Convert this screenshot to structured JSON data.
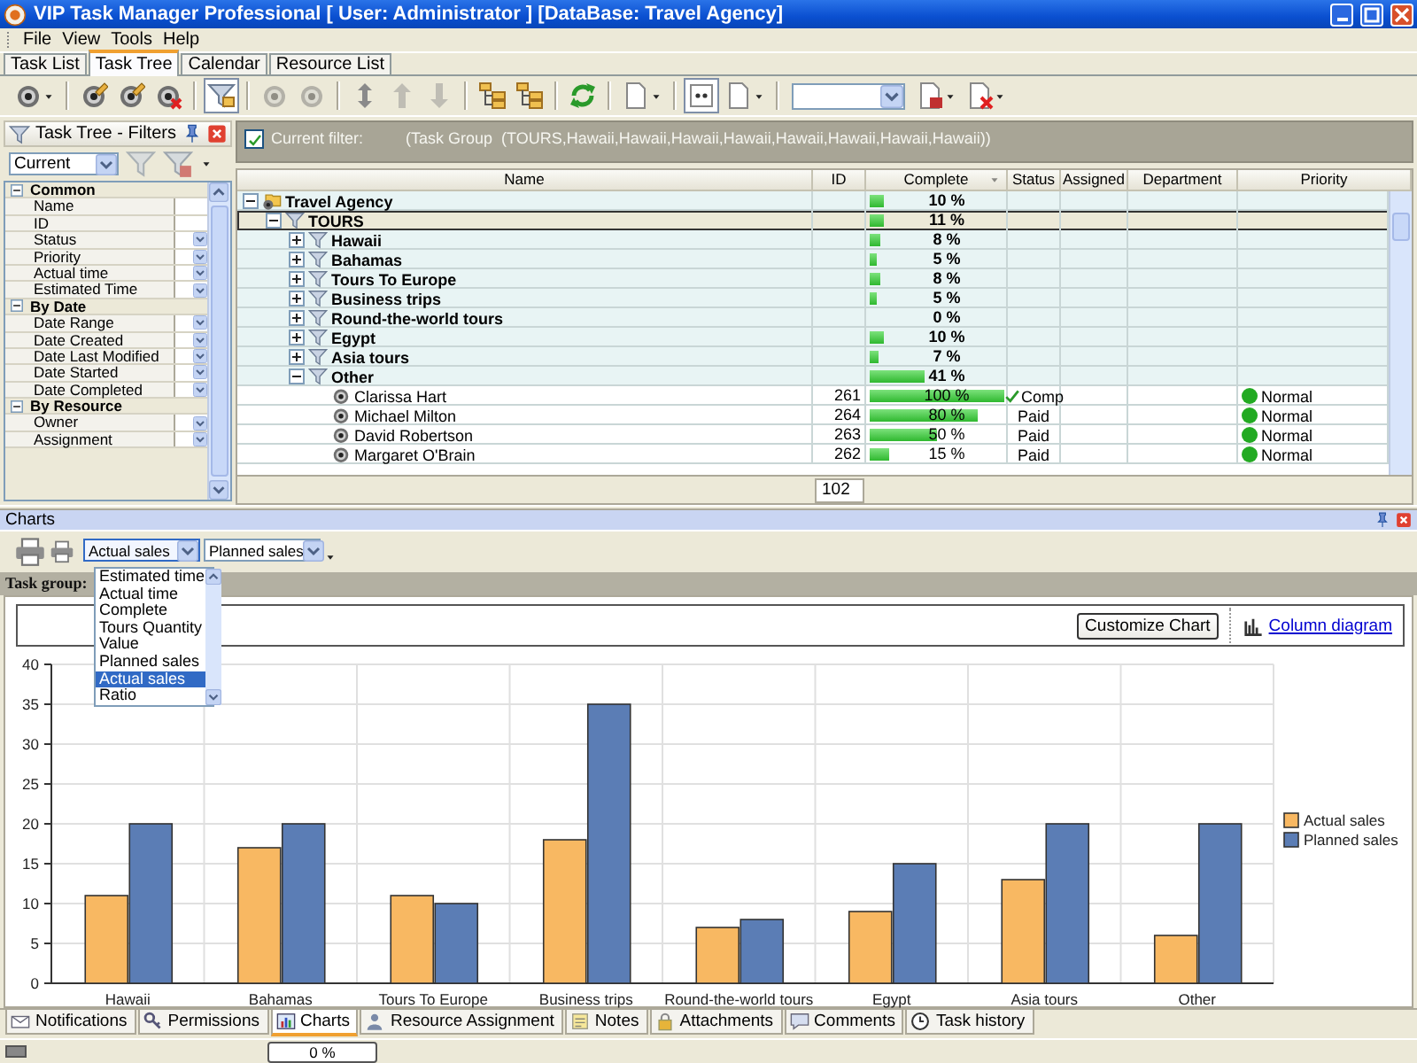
{
  "window": {
    "title": "VIP Task Manager Professional [ User: Administrator ] [DataBase: Travel Agency]"
  },
  "menu": [
    "File",
    "View",
    "Tools",
    "Help"
  ],
  "view_tabs": [
    {
      "label": "Task List",
      "selected": false
    },
    {
      "label": "Task Tree",
      "selected": true
    },
    {
      "label": "Calendar",
      "selected": false
    },
    {
      "label": "Resource List",
      "selected": false
    }
  ],
  "toolbar": [
    {
      "kind": "gear",
      "menu": true,
      "pressed": false,
      "disabled": false
    },
    {
      "kind": "separator"
    },
    {
      "kind": "gear-edit",
      "menu": false,
      "pressed": false,
      "disabled": false
    },
    {
      "kind": "gear-edit",
      "menu": false,
      "pressed": false,
      "disabled": false
    },
    {
      "kind": "gear-delete",
      "menu": false,
      "pressed": false,
      "disabled": false
    },
    {
      "kind": "separator"
    },
    {
      "kind": "funnel",
      "menu": false,
      "pressed": true,
      "disabled": false
    },
    {
      "kind": "separator"
    },
    {
      "kind": "gear",
      "menu": false,
      "pressed": false,
      "disabled": true
    },
    {
      "kind": "gear",
      "menu": false,
      "pressed": false,
      "disabled": true
    },
    {
      "kind": "separator"
    },
    {
      "kind": "up-down",
      "menu": false,
      "pressed": false,
      "disabled": false
    },
    {
      "kind": "up",
      "menu": false,
      "pressed": false,
      "disabled": true
    },
    {
      "kind": "down",
      "menu": false,
      "pressed": false,
      "disabled": true
    },
    {
      "kind": "separator"
    },
    {
      "kind": "tree",
      "menu": false,
      "pressed": false,
      "disabled": false
    },
    {
      "kind": "tree",
      "menu": false,
      "pressed": false,
      "disabled": false
    },
    {
      "kind": "separator"
    },
    {
      "kind": "refresh",
      "menu": false,
      "pressed": false,
      "disabled": false
    },
    {
      "kind": "separator"
    },
    {
      "kind": "page",
      "menu": true,
      "pressed": false,
      "disabled": false
    },
    {
      "kind": "separator"
    },
    {
      "kind": "columns",
      "menu": false,
      "pressed": true,
      "disabled": false
    },
    {
      "kind": "page",
      "menu": true,
      "pressed": false,
      "disabled": false
    },
    {
      "kind": "separator"
    },
    {
      "kind": "combo"
    },
    {
      "kind": "page-save",
      "menu": true,
      "pressed": false,
      "disabled": false
    },
    {
      "kind": "page-delete",
      "menu": true,
      "pressed": false,
      "disabled": false
    }
  ],
  "filters": {
    "title": "Task Tree - Filters",
    "preset": "Current",
    "groups": [
      {
        "label": "Common",
        "expanded": true,
        "items": [
          {
            "label": "Name",
            "dropdown": false
          },
          {
            "label": "ID",
            "dropdown": false
          },
          {
            "label": "Status",
            "dropdown": true
          },
          {
            "label": "Priority",
            "dropdown": true
          },
          {
            "label": "Actual time",
            "dropdown": true
          },
          {
            "label": "Estimated Time",
            "dropdown": true
          }
        ]
      },
      {
        "label": "By Date",
        "expanded": true,
        "items": [
          {
            "label": "Date Range",
            "dropdown": true
          },
          {
            "label": "Date Created",
            "dropdown": true
          },
          {
            "label": "Date Last Modified",
            "dropdown": true
          },
          {
            "label": "Date Started",
            "dropdown": true
          },
          {
            "label": "Date Completed",
            "dropdown": true
          }
        ]
      },
      {
        "label": "By Resource",
        "expanded": true,
        "items": [
          {
            "label": "Owner",
            "dropdown": true
          },
          {
            "label": "Assignment",
            "dropdown": true
          }
        ]
      }
    ]
  },
  "filter_bar": {
    "checked": true,
    "label": "Current filter:",
    "value": "(Task Group  (TOURS,Hawaii,Hawaii,Hawaii,Hawaii,Hawaii,Hawaii,Hawaii,Hawaii))"
  },
  "tree": {
    "columns": [
      "Name",
      "ID",
      "Complete",
      "Status",
      "Assigned",
      "Department",
      "Priority"
    ],
    "rows": [
      {
        "kind": "root",
        "name": "Travel Agency",
        "complete": "10 %",
        "level": 0.1,
        "expanded": true,
        "selected": false,
        "children": [
          {
            "kind": "group",
            "name": "TOURS",
            "complete": "11 %",
            "level": 0.11,
            "expanded": true,
            "selected": true,
            "children": [
              {
                "kind": "group",
                "name": "Hawaii",
                "complete": "8 %",
                "level": 0.08,
                "expanded": false,
                "selected": false
              },
              {
                "kind": "group",
                "name": "Bahamas",
                "complete": "5 %",
                "level": 0.05,
                "expanded": false,
                "selected": false
              },
              {
                "kind": "group",
                "name": "Tours To Europe",
                "complete": "8 %",
                "level": 0.08,
                "expanded": false,
                "selected": false
              },
              {
                "kind": "group",
                "name": "Business trips",
                "complete": "5 %",
                "level": 0.05,
                "expanded": false,
                "selected": false
              },
              {
                "kind": "group",
                "name": "Round-the-world tours",
                "complete": "0 %",
                "level": 0,
                "expanded": false,
                "selected": false
              },
              {
                "kind": "group",
                "name": "Egypt",
                "complete": "10 %",
                "level": 0.1,
                "expanded": false,
                "selected": false
              },
              {
                "kind": "group",
                "name": "Asia tours",
                "complete": "7 %",
                "level": 0.07,
                "expanded": false,
                "selected": false
              },
              {
                "kind": "group",
                "name": "Other",
                "complete": "41 %",
                "level": 0.41,
                "expanded": true,
                "selected": false,
                "children": [
                  {
                    "kind": "task",
                    "name": "Clarissa Hart",
                    "id": "261",
                    "complete": "100 %",
                    "level": 1,
                    "status": "Comp",
                    "completed": true,
                    "priority": "Normal",
                    "color": "#22aa22",
                    "selected": false
                  },
                  {
                    "kind": "task",
                    "name": "Michael Milton",
                    "id": "264",
                    "complete": "80 %",
                    "level": 0.8,
                    "status": "Paid",
                    "completed": false,
                    "priority": "Normal",
                    "color": "#22aa22",
                    "selected": false
                  },
                  {
                    "kind": "task",
                    "name": "David Robertson",
                    "id": "263",
                    "complete": "50 %",
                    "level": 0.5,
                    "status": "Paid",
                    "completed": false,
                    "priority": "Normal",
                    "color": "#22aa22",
                    "selected": false
                  },
                  {
                    "kind": "task",
                    "name": "Margaret O'Brain",
                    "id": "262",
                    "complete": "15 %",
                    "level": 0.15,
                    "status": "Paid",
                    "completed": false,
                    "priority": "Normal",
                    "color": "#22aa22",
                    "selected": false
                  }
                ]
              }
            ]
          }
        ]
      }
    ],
    "footer_id": "102"
  },
  "charts": {
    "title": "Charts",
    "combos": [
      {
        "value": "Actual sales",
        "open": true,
        "options": [
          {
            "label": "Estimated time",
            "selected": false
          },
          {
            "label": "Actual time",
            "selected": false
          },
          {
            "label": "Complete",
            "selected": false
          },
          {
            "label": "Tours Quantity",
            "selected": false
          },
          {
            "label": "Value",
            "selected": false
          },
          {
            "label": "Planned sales",
            "selected": false
          },
          {
            "label": "Actual sales",
            "selected": true
          },
          {
            "label": "Ratio",
            "selected": false
          }
        ]
      },
      {
        "value": "Planned sales",
        "open": false
      }
    ],
    "band_label": "Task group:",
    "customize_button": "Customize Chart",
    "view_link": "Column diagram",
    "chart_data": {
      "type": "bar",
      "categories": [
        "Hawaii",
        "Bahamas",
        "Tours To Europe",
        "Business trips",
        "Round-the-world tours",
        "Egypt",
        "Asia tours",
        "Other"
      ],
      "series": [
        {
          "name": "Actual sales",
          "color": "#f8b862",
          "values": [
            11,
            17,
            11,
            18,
            7,
            9,
            13,
            6
          ]
        },
        {
          "name": "Planned sales",
          "color": "#5b7db5",
          "values": [
            20,
            20,
            10,
            35,
            8,
            15,
            20,
            20
          ]
        }
      ],
      "ylim": [
        0,
        40
      ],
      "yticks": [
        0,
        5,
        10,
        15,
        20,
        25,
        30,
        35,
        40
      ],
      "grid": true,
      "legend": "right"
    }
  },
  "bottom_tabs": [
    {
      "label": "Notifications",
      "selected": false
    },
    {
      "label": "Permissions",
      "selected": false
    },
    {
      "label": "Charts",
      "selected": true
    },
    {
      "label": "Resource Assignment",
      "selected": false
    },
    {
      "label": "Notes",
      "selected": false
    },
    {
      "label": "Attachments",
      "selected": false
    },
    {
      "label": "Comments",
      "selected": false
    },
    {
      "label": "Task history",
      "selected": false
    }
  ],
  "status_bar": {
    "progress": "0 %",
    "level": 0
  }
}
